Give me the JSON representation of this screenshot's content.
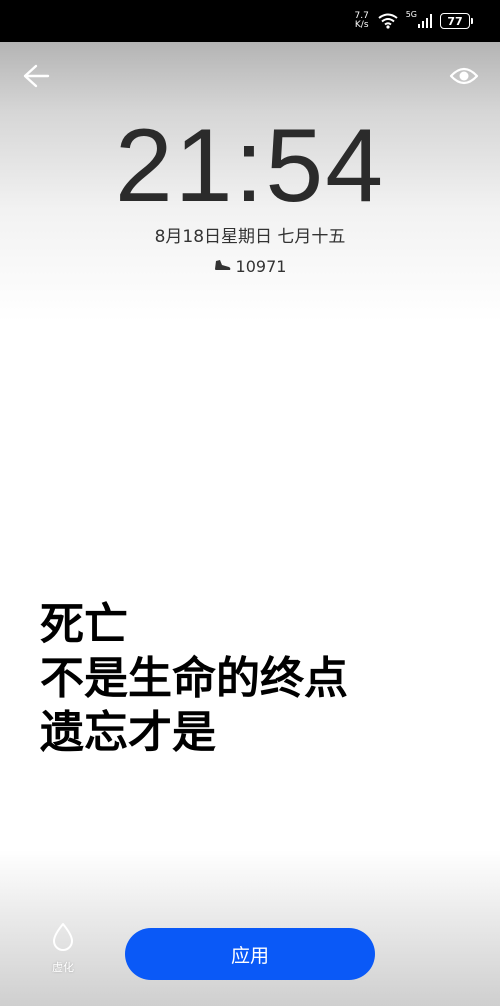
{
  "status_bar": {
    "net_speed_value": "7.7",
    "net_speed_unit": "K/s",
    "network_type": "5G",
    "battery_level": "77"
  },
  "lock_preview": {
    "time": "21:54",
    "date": "8月18日星期日  七月十五",
    "steps": "10971"
  },
  "quote": {
    "lines": [
      "死亡",
      "不是生命的终点",
      "遗忘才是"
    ]
  },
  "bottom_bar": {
    "blur_label": "虚化",
    "apply_label": "应用"
  },
  "colors": {
    "accent": "#0a59f7",
    "clock_text": "#2b2b2b"
  },
  "icons": [
    "back-arrow-icon",
    "eye-icon",
    "wifi-icon",
    "signal-icon",
    "battery-icon",
    "shoe-icon",
    "water-drop-icon"
  ]
}
